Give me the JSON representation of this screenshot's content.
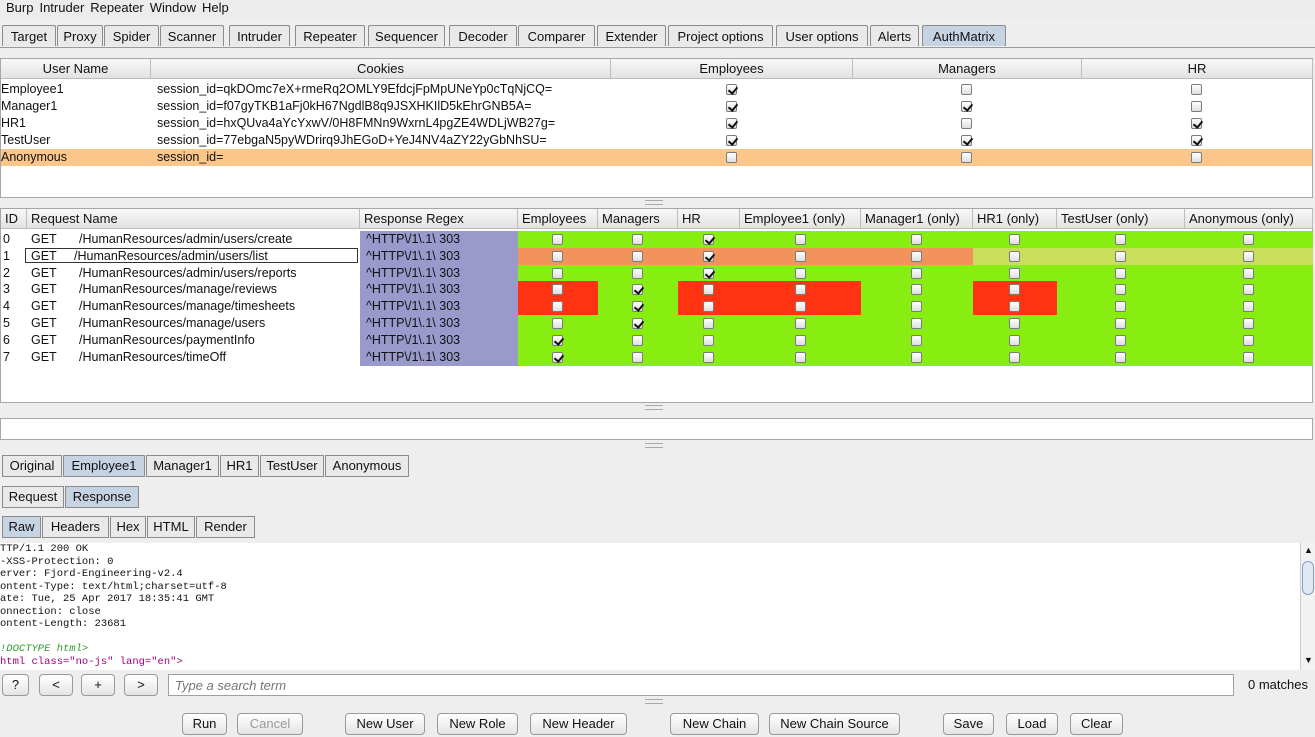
{
  "menu": [
    "Burp",
    "Intruder",
    "Repeater",
    "Window",
    "Help"
  ],
  "tabs": [
    "Target",
    "Proxy",
    "Spider",
    "Scanner",
    "Intruder",
    "Repeater",
    "Sequencer",
    "Decoder",
    "Comparer",
    "Extender",
    "Project options",
    "User options",
    "Alerts",
    "AuthMatrix"
  ],
  "selected_tab": "AuthMatrix",
  "users_table": {
    "headers": [
      "User Name",
      "Cookies",
      "Employees",
      "Managers",
      "HR"
    ],
    "rows": [
      {
        "name": "Employee1",
        "cookie": "session_id=qkDOmc7eX+rmeRq2OMLY9EfdcjFpMpUNeYp0cTqNjCQ=",
        "roles": [
          true,
          false,
          false
        ]
      },
      {
        "name": "Manager1",
        "cookie": "session_id=f07gyTKB1aFj0kH67NgdlB8q9JSXHKIlD5kEhrGNB5A=",
        "roles": [
          true,
          true,
          false
        ]
      },
      {
        "name": "HR1",
        "cookie": "session_id=hxQUva4aYcYxwV/0H8FMNn9WxrnL4pgZE4WDLjWB27g=",
        "roles": [
          true,
          false,
          true
        ]
      },
      {
        "name": "TestUser",
        "cookie": "session_id=77ebgaN5pyWDrirq9JhEGoD+YeJ4NV4aZY22yGbNhSU=",
        "roles": [
          true,
          true,
          true
        ]
      },
      {
        "name": "Anonymous",
        "cookie": "session_id=",
        "roles": [
          false,
          false,
          false
        ]
      }
    ]
  },
  "requests_table": {
    "headers": [
      "ID",
      "Request Name",
      "Response Regex",
      "Employees",
      "Managers",
      "HR",
      "Employee1 (only)",
      "Manager1 (only)",
      "HR1 (only)",
      "TestUser (only)",
      "Anonymous (only)"
    ],
    "rows": [
      {
        "id": "0",
        "method": "GET",
        "path": "/HumanResources/admin/users/create",
        "regex": "^HTTP\\/1\\.1\\ 303",
        "checks": [
          false,
          false,
          true,
          false,
          false,
          false,
          false,
          false
        ],
        "colors": [
          "g",
          "g",
          "g",
          "g",
          "g",
          "g",
          "g",
          "g"
        ]
      },
      {
        "id": "1",
        "method": "GET",
        "path": "/HumanResources/admin/users/list",
        "regex": "^HTTP\\/1\\.1\\ 303",
        "checks": [
          false,
          false,
          true,
          false,
          false,
          false,
          false,
          false
        ],
        "colors": [
          "o",
          "o",
          "o",
          "o",
          "o",
          "y",
          "y",
          "y"
        ]
      },
      {
        "id": "2",
        "method": "GET",
        "path": "/HumanResources/admin/users/reports",
        "regex": "^HTTP\\/1\\.1\\ 303",
        "checks": [
          false,
          false,
          true,
          false,
          false,
          false,
          false,
          false
        ],
        "colors": [
          "g",
          "g",
          "g",
          "g",
          "g",
          "g",
          "g",
          "g"
        ]
      },
      {
        "id": "3",
        "method": "GET",
        "path": "/HumanResources/manage/reviews",
        "regex": "^HTTP\\/1\\.1\\ 303",
        "checks": [
          false,
          true,
          false,
          false,
          false,
          false,
          false,
          false
        ],
        "colors": [
          "r",
          "g",
          "r",
          "r",
          "g",
          "r",
          "g",
          "g"
        ]
      },
      {
        "id": "4",
        "method": "GET",
        "path": "/HumanResources/manage/timesheets",
        "regex": "^HTTP\\/1\\.1\\ 303",
        "checks": [
          false,
          true,
          false,
          false,
          false,
          false,
          false,
          false
        ],
        "colors": [
          "r",
          "g",
          "r",
          "r",
          "g",
          "r",
          "g",
          "g"
        ]
      },
      {
        "id": "5",
        "method": "GET",
        "path": "/HumanResources/manage/users",
        "regex": "^HTTP\\/1\\.1\\ 303",
        "checks": [
          false,
          true,
          false,
          false,
          false,
          false,
          false,
          false
        ],
        "colors": [
          "g",
          "g",
          "g",
          "g",
          "g",
          "g",
          "g",
          "g"
        ]
      },
      {
        "id": "6",
        "method": "GET",
        "path": "/HumanResources/paymentInfo",
        "regex": "^HTTP\\/1\\.1\\ 303",
        "checks": [
          true,
          false,
          false,
          false,
          false,
          false,
          false,
          false
        ],
        "colors": [
          "g",
          "g",
          "g",
          "g",
          "g",
          "g",
          "g",
          "g"
        ]
      },
      {
        "id": "7",
        "method": "GET",
        "path": "/HumanResources/timeOff",
        "regex": "^HTTP\\/1\\.1\\ 303",
        "checks": [
          true,
          false,
          false,
          false,
          false,
          false,
          false,
          false
        ],
        "colors": [
          "g",
          "g",
          "g",
          "g",
          "g",
          "g",
          "g",
          "g"
        ]
      }
    ]
  },
  "colors": {
    "green": "#88ee11",
    "red": "#ff3311",
    "orange": "#f2935c",
    "yellow": "#c9de5a",
    "regex_bg": "#9999cc",
    "anon_row": "#fbc68a",
    "selected_row_bg": "#d9b8a4"
  },
  "user_tabs": [
    "Original",
    "Employee1",
    "Manager1",
    "HR1",
    "TestUser",
    "Anonymous"
  ],
  "selected_user_tab": "Employee1",
  "reqresp_tabs": [
    "Request",
    "Response"
  ],
  "selected_reqresp_tab": "Response",
  "view_tabs": [
    "Raw",
    "Headers",
    "Hex",
    "HTML",
    "Render"
  ],
  "selected_view_tab": "Raw",
  "response_lines": [
    "TTP/1.1 200 OK",
    "-XSS-Protection: 0",
    "erver: Fjord-Engineering-v2.4",
    "ontent-Type: text/html;charset=utf-8",
    "ate: Tue, 25 Apr 2017 18:35:41 GMT",
    "onnection: close",
    "ontent-Length: 23681",
    "",
    "!DOCTYPE html>",
    "html class=\"no-js\" lang=\"en\">"
  ],
  "search": {
    "help": "?",
    "prev": "<",
    "add": "+",
    "next": ">",
    "placeholder": "Type a search term",
    "matches": "0 matches"
  },
  "bottom_buttons": {
    "run": "Run",
    "cancel": "Cancel",
    "new_user": "New User",
    "new_role": "New Role",
    "new_header": "New Header",
    "new_chain": "New Chain",
    "new_chain_source": "New Chain Source",
    "save": "Save",
    "load": "Load",
    "clear": "Clear"
  }
}
